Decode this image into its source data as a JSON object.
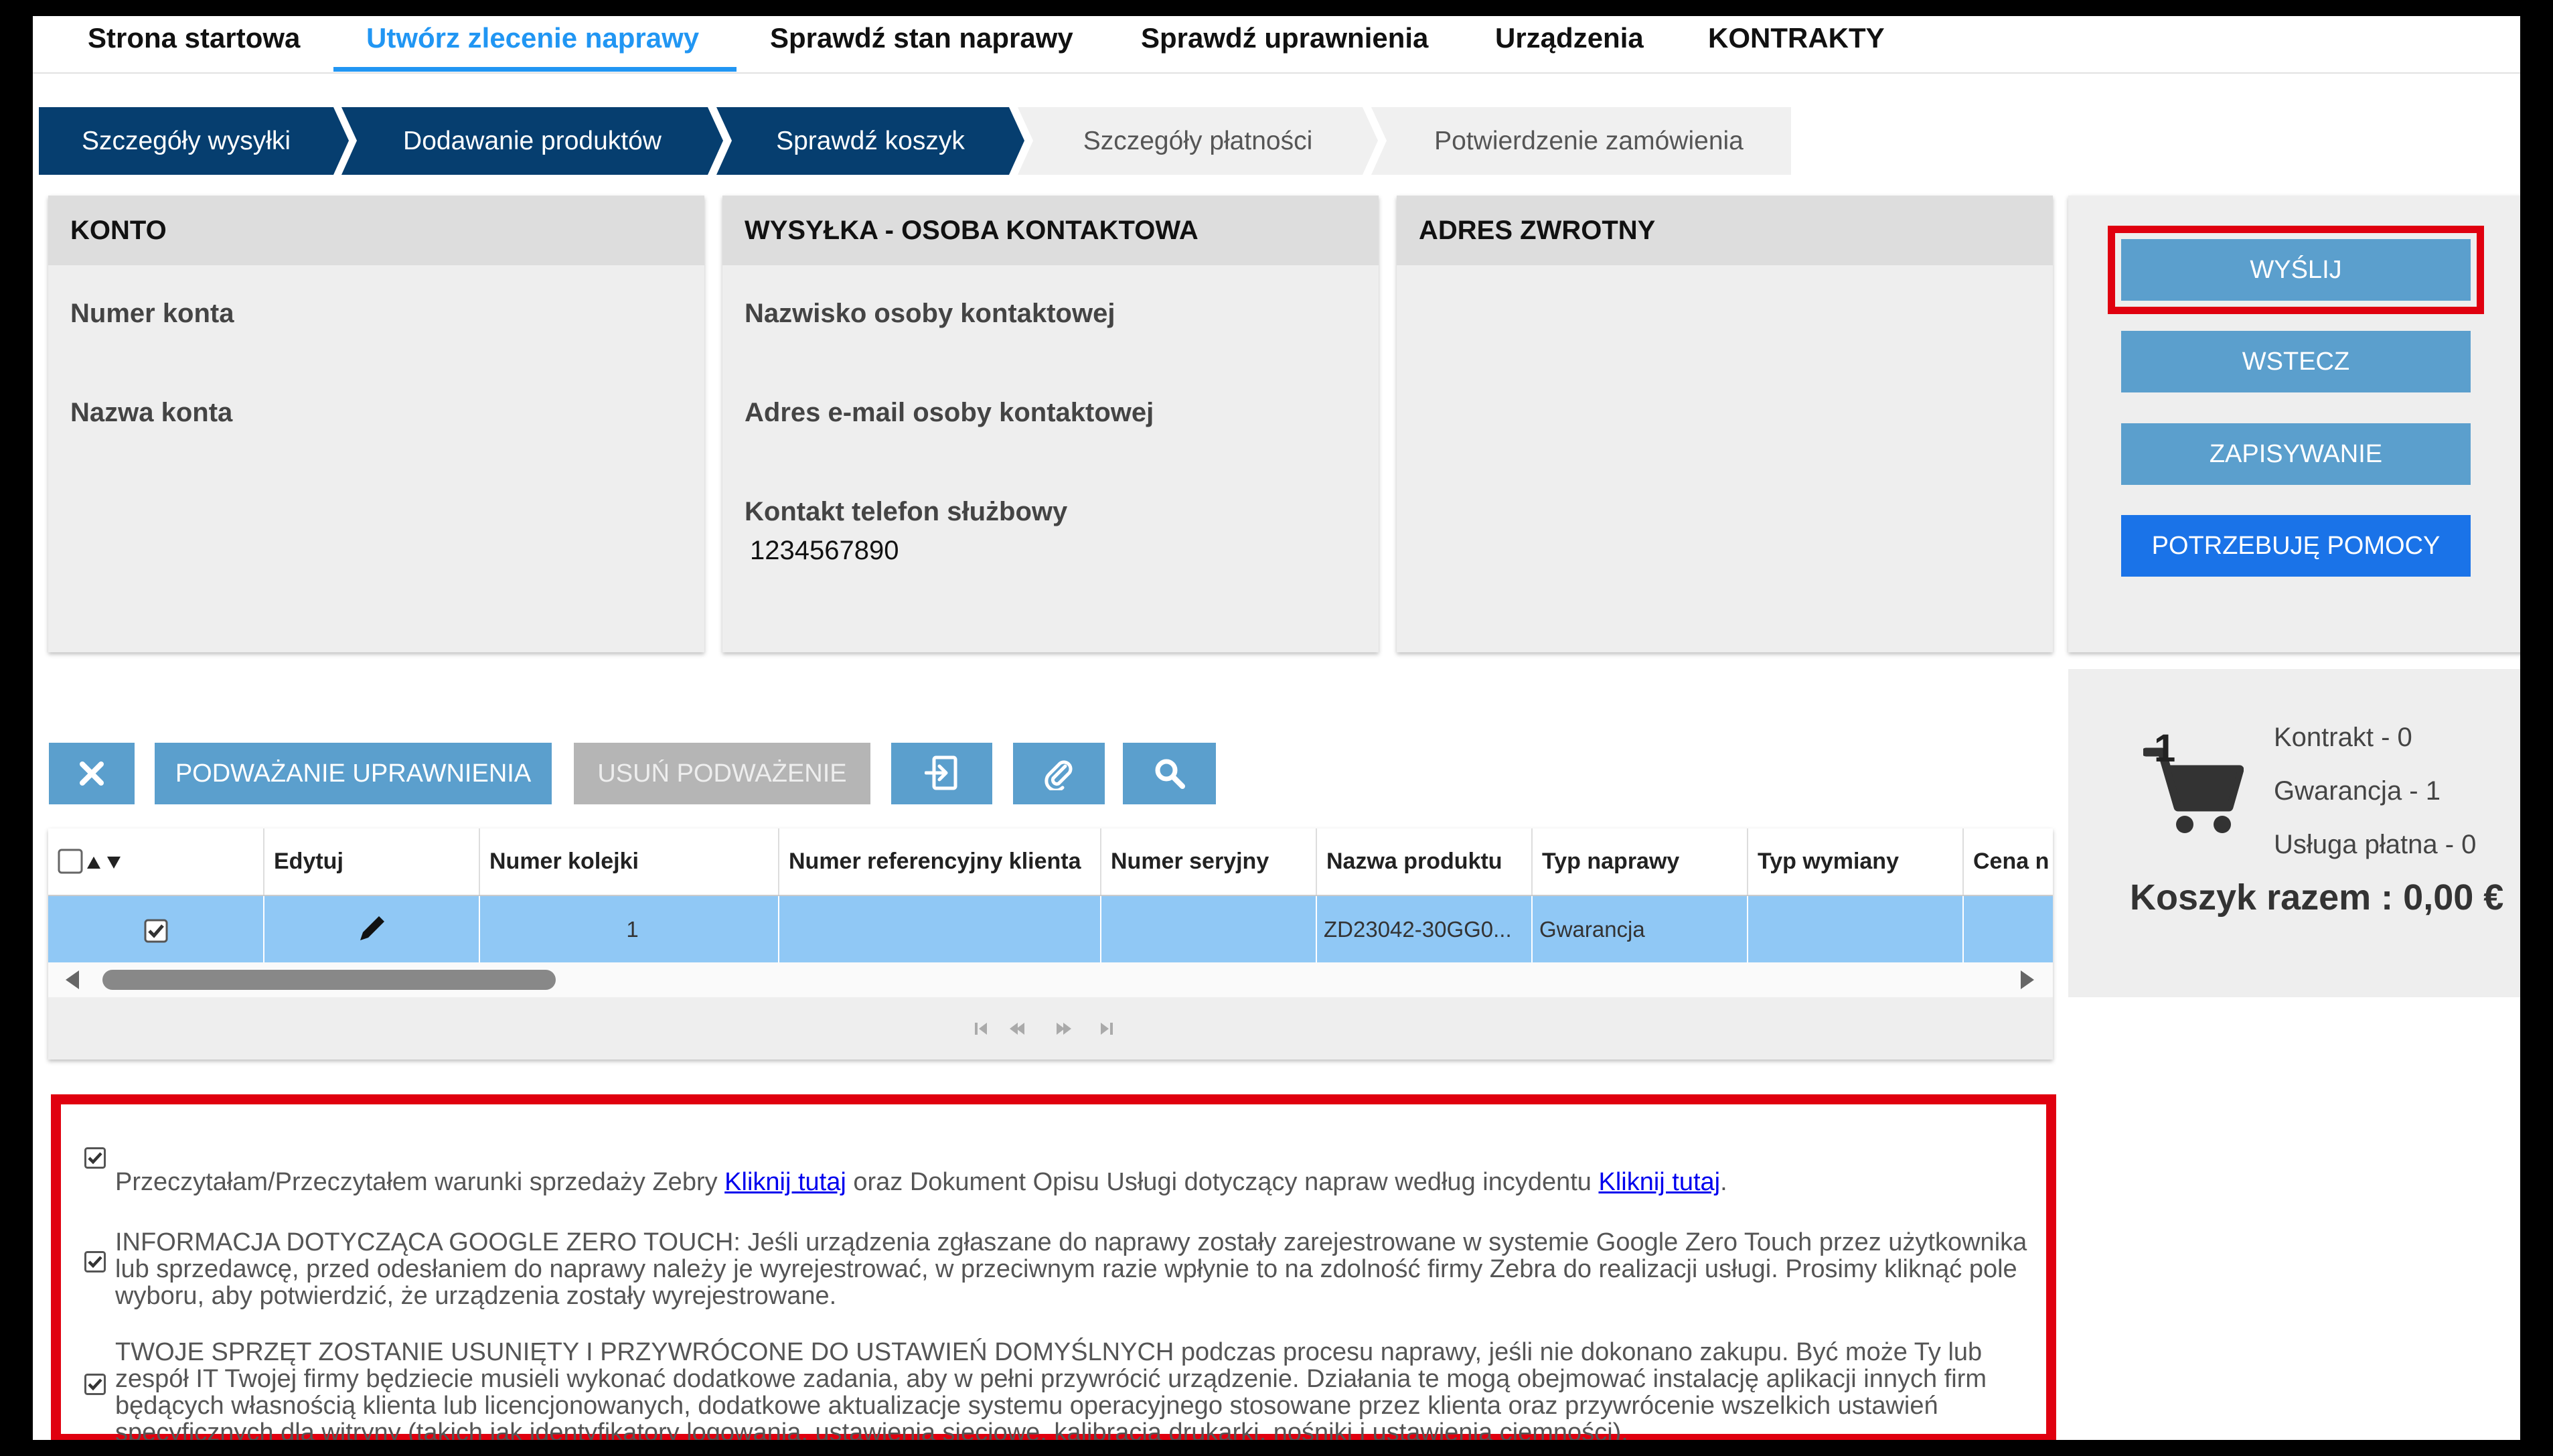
{
  "nav": {
    "items": [
      {
        "label": "Strona startowa",
        "active": false
      },
      {
        "label": "Utwórz zlecenie naprawy",
        "active": true
      },
      {
        "label": "Sprawdź stan naprawy",
        "active": false
      },
      {
        "label": "Sprawdź uprawnienia",
        "active": false
      },
      {
        "label": "Urządzenia",
        "active": false
      },
      {
        "label": "KONTRAKTY",
        "active": false
      }
    ]
  },
  "steps": [
    {
      "label": "Szczegóły wysyłki",
      "done": true
    },
    {
      "label": "Dodawanie produktów",
      "done": true
    },
    {
      "label": "Sprawdź koszyk",
      "done": true
    },
    {
      "label": "Szczegóły płatności",
      "done": false
    },
    {
      "label": "Potwierdzenie zamówienia",
      "done": false
    }
  ],
  "account": {
    "title": "KONTO",
    "number_label": "Numer konta",
    "name_label": "Nazwa konta"
  },
  "shipping": {
    "title": "WYSYŁKA - OSOBA KONTAKTOWA",
    "contact_name_label": "Nazwisko osoby kontaktowej",
    "contact_email_label": "Adres e-mail osoby kontaktowej",
    "phone_label": "Kontakt telefon służbowy",
    "phone_value": "1234567890"
  },
  "return_address": {
    "title": "ADRES ZWROTNY"
  },
  "actions": {
    "send": "WYŚLIJ",
    "back": "WSTECZ",
    "save": "ZAPISYWANIE",
    "help": "POTRZEBUJĘ POMOCY"
  },
  "cart": {
    "count": "1",
    "contract": "Kontrakt - 0",
    "warranty": "Gwarancja - 1",
    "paid": "Usługa płatna - 0",
    "total": "Koszyk razem : 0,00 €"
  },
  "toolbar": {
    "challenge": "PODWAŻANIE UPRAWNIENIA",
    "remove_challenge": "USUŃ PODWAŻENIE"
  },
  "grid": {
    "columns": [
      "Edytuj",
      "Numer kolejki",
      "Numer referencyjny klienta",
      "Numer seryjny",
      "Nazwa produktu",
      "Typ naprawy",
      "Typ wymiany",
      "Cena n"
    ],
    "row": {
      "queue_number": "1",
      "client_ref": "",
      "serial": "",
      "product": "ZD23042-30GG0...",
      "repair_type": "Gwarancja",
      "exchange_type": "",
      "price": ""
    }
  },
  "agreements": {
    "terms_a": "Przeczytałam/Przeczytałem warunki sprzedaży Zebry ",
    "terms_link1": "Kliknij tutaj",
    "terms_b": " oraz Dokument Opisu Usługi dotyczący napraw według incydentu ",
    "terms_link2": "Kliknij tutaj",
    "terms_c": ".",
    "google": "INFORMACJA DOTYCZĄCA GOOGLE ZERO TOUCH: Jeśli urządzenia zgłaszane do naprawy zostały zarejestrowane w systemie Google Zero Touch przez użytkownika lub sprzedawcę, przed odesłaniem do naprawy należy je wyrejestrować, w przeciwnym razie wpłynie to na zdolność firmy Zebra do realizacji usługi. Prosimy kliknąć pole wyboru, aby potwierdzić, że urządzenia zostały wyrejestrowane.",
    "reset": "TWOJE SPRZĘT ZOSTANIE USUNIĘTY I PRZYWRÓCONE DO USTAWIEŃ DOMYŚLNYCH podczas procesu naprawy, jeśli nie dokonano zakupu. Być może Ty lub zespół IT Twojej firmy będziecie musieli wykonać dodatkowe zadania, aby w pełni przywrócić urządzenie. Działania te mogą obejmować instalację aplikacji innych firm będących własnością klienta lub licencjonowanych, dodatkowe aktualizacje systemu operacyjnego stosowane przez klienta oraz przywrócenie wszelkich ustawień specyficznych dla witryny (takich jak identyfikatory logowania, ustawienia sieciowe, kalibracja drukarki, nośniki i ustawienia ciemności)."
  },
  "colors": {
    "accent": "#2196f3",
    "step_done": "#063e6f",
    "button": "#5b9fcd",
    "primary": "#1a73e8",
    "highlight": "#e0000f",
    "row_selected": "#90c8f5"
  },
  "icons": [
    "close-icon",
    "import-icon",
    "paperclip-icon",
    "search-icon",
    "pencil-icon",
    "cart-icon",
    "sort-arrows-icon"
  ]
}
